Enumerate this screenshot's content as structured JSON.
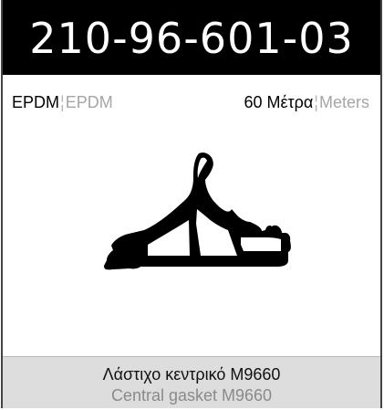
{
  "header": {
    "code": "210-96-601-03"
  },
  "specs": {
    "material_primary": "EPDM",
    "material_secondary": "EPDM",
    "length_primary": "60 Μέτρα",
    "length_secondary": "Meters",
    "separator": "¦"
  },
  "footer": {
    "title_primary": "Λάστιχο κεντρικό M9660",
    "title_secondary": "Central gasket M9660"
  },
  "colors": {
    "header_bg": "#000000",
    "header_text": "#ffffff",
    "secondary_text": "#a6a6a6",
    "footer_bg": "#dddddd"
  },
  "icons": {
    "profile_drawing": "gasket-profile-icon"
  }
}
